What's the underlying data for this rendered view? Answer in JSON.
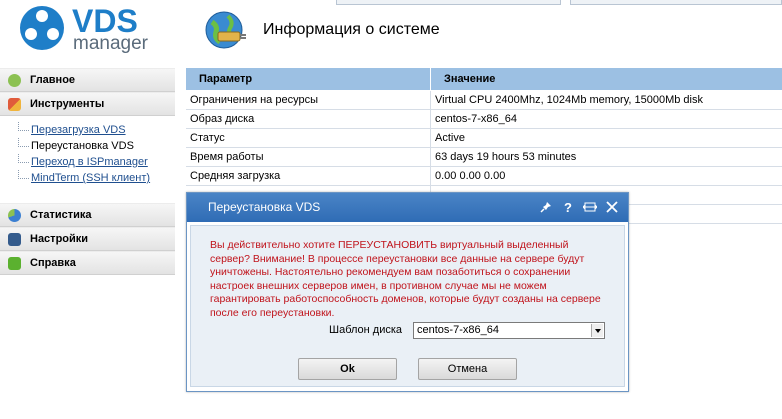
{
  "app": {
    "logo_main": "VDS",
    "logo_sub": "manager",
    "page_title": "Информация о системе"
  },
  "sidebar": {
    "sections": [
      {
        "label": "Главное",
        "icon": "home-icon",
        "color": "#8cc152"
      },
      {
        "label": "Инструменты",
        "icon": "tools-icon",
        "color": "#e05b3b"
      },
      {
        "label": "Статистика",
        "icon": "statistics-icon",
        "color": "#3b7fd1"
      },
      {
        "label": "Настройки",
        "icon": "settings-icon",
        "color": "#345b8c"
      },
      {
        "label": "Справка",
        "icon": "help-icon",
        "color": "#5bb12f"
      }
    ],
    "tools_items": [
      {
        "label": "Перезагрузка VDS",
        "link": true
      },
      {
        "label": "Переустановка VDS",
        "link": false
      },
      {
        "label": "Переход в ISPmanager",
        "link": true
      },
      {
        "label": "MindTerm (SSH клиент)",
        "link": true
      }
    ]
  },
  "table": {
    "headers": [
      "Параметр",
      "Значение"
    ],
    "rows": [
      [
        "Ограничения на ресурсы",
        "Virtual CPU 2400Mhz, 1024Mb memory, 15000Mb disk"
      ],
      [
        "Образ диска",
        "centos-7-x86_64"
      ],
      [
        "Статус",
        "Active"
      ],
      [
        "Время работы",
        "63 days 19 hours 53 minutes"
      ],
      [
        "Средняя загрузка",
        "0.00 0.00 0.00"
      ]
    ]
  },
  "dialog": {
    "title": "Переустановка VDS",
    "message": "Вы действительно хотите ПЕРЕУСТАНОВИТЬ виртуальный выделенный сервер? Внимание! В процессе переустановки все данные на сервере будут уничтожены. Настоятельно рекомендуем вам позаботиться о сохранении настроек внешних серверов имен, в противном случае мы не можем гарантировать работоспособность доменов, которые будут созданы на сервере после его переустановки.",
    "template_label": "Шаблон диска",
    "template_value": "centos-7-x86_64",
    "ok_label": "Ok",
    "cancel_label": "Отмена",
    "tools": [
      "pin-icon",
      "help-icon",
      "expand-icon",
      "close-icon"
    ]
  },
  "colors": {
    "accent": "#1e7ec8",
    "table_header": "#9cc0e3",
    "dialog_title": "#3a76bd",
    "warning_text": "#c0131b"
  }
}
